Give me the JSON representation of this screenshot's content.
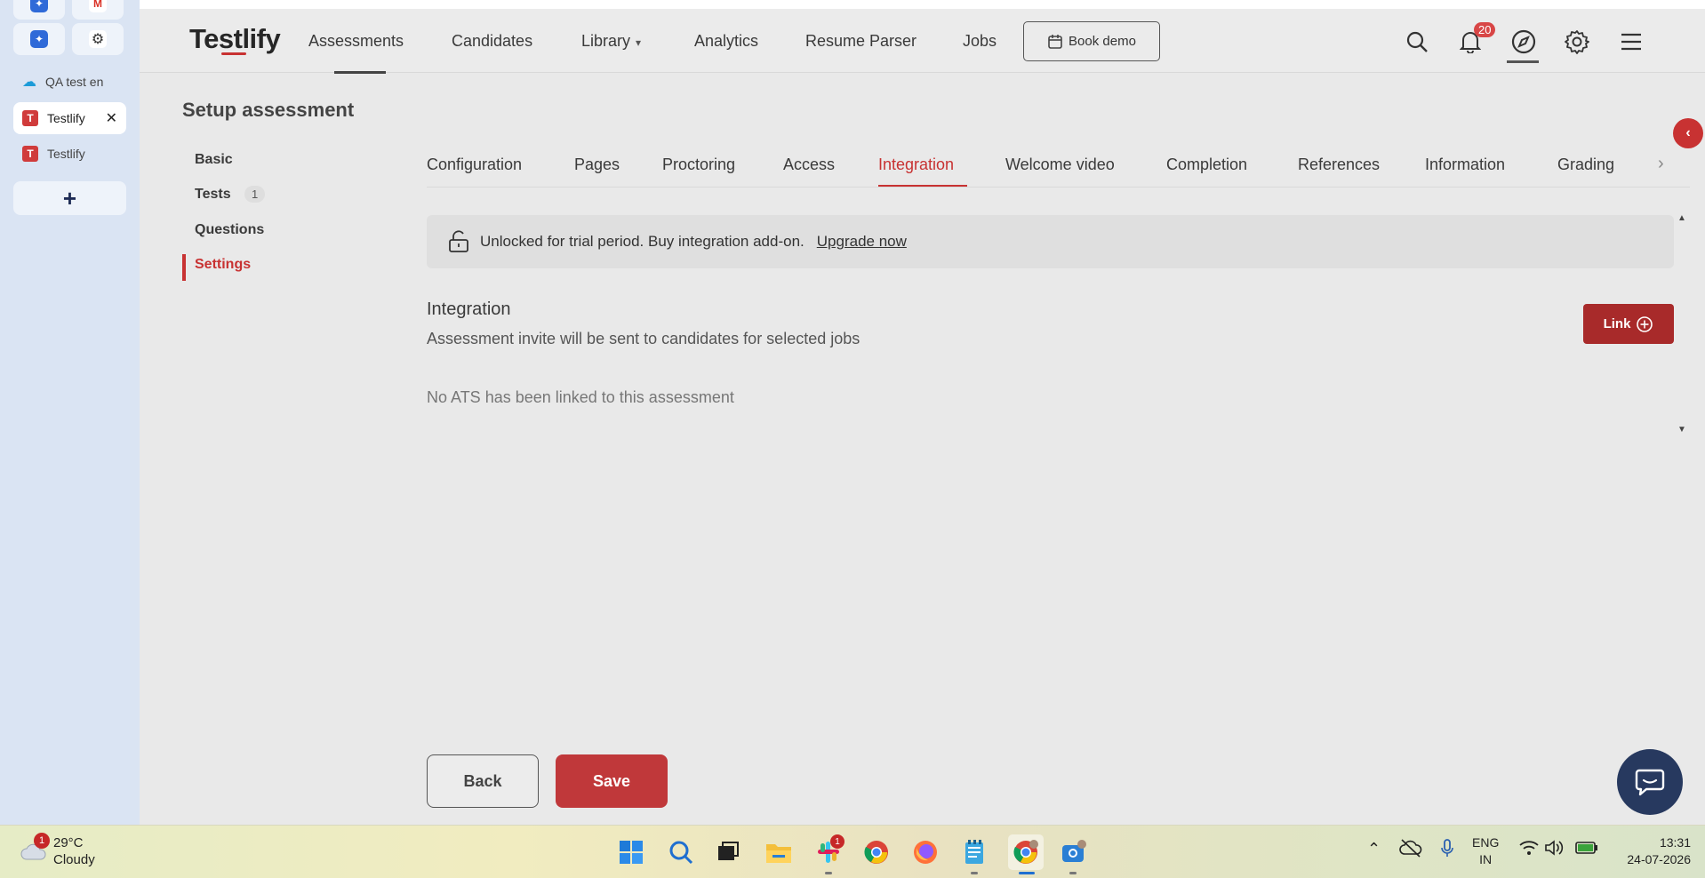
{
  "browser_sidebar": {
    "pinned": [
      {
        "icon": "app-blue-icon"
      },
      {
        "icon": "gmail-icon"
      },
      {
        "icon": "app-blue-icon"
      },
      {
        "icon": "openai-icon"
      }
    ],
    "tabs": [
      {
        "label": "QA test en",
        "icon": "cloud-icon"
      },
      {
        "label": "Testlify",
        "icon": "testlify-icon",
        "favicon": "T"
      },
      {
        "label": "Testlify",
        "icon": "testlify-icon",
        "favicon": "T"
      }
    ],
    "new_tab": "+"
  },
  "header": {
    "logo": "Testlify",
    "nav": [
      "Assessments",
      "Candidates",
      "Library",
      "Analytics",
      "Resume Parser",
      "Jobs"
    ],
    "book_demo": "Book demo",
    "notification_count": "20"
  },
  "setup": {
    "title": "Setup assessment",
    "left_nav": [
      "Basic",
      "Tests",
      "Questions",
      "Settings"
    ],
    "tests_count": "1",
    "active_left": "Settings"
  },
  "tabs": [
    "Configuration",
    "Pages",
    "Proctoring",
    "Access",
    "Integration",
    "Welcome video",
    "Completion",
    "References",
    "Information",
    "Grading"
  ],
  "active_tab": "Integration",
  "notice": {
    "text": "Unlocked for trial period. Buy integration add-on.",
    "link": "Upgrade now"
  },
  "integration": {
    "title": "Integration",
    "subtitle": "Assessment invite will be sent to candidates for selected jobs",
    "empty": "No ATS has been linked to this assessment",
    "link_button": "Link"
  },
  "footer": {
    "back": "Back",
    "save": "Save"
  },
  "taskbar": {
    "weather_temp": "29°C",
    "weather_desc": "Cloudy",
    "weather_badge": "1",
    "slack_badge": "1",
    "lang_top": "ENG",
    "lang_bottom": "IN",
    "time": "13:31",
    "date": "24-07-2026"
  },
  "colors": {
    "brand_red": "#c83232",
    "button_dark_red": "#a82a2a",
    "sidebar_bg": "#dae4f3",
    "chat_navy": "#27395f"
  }
}
